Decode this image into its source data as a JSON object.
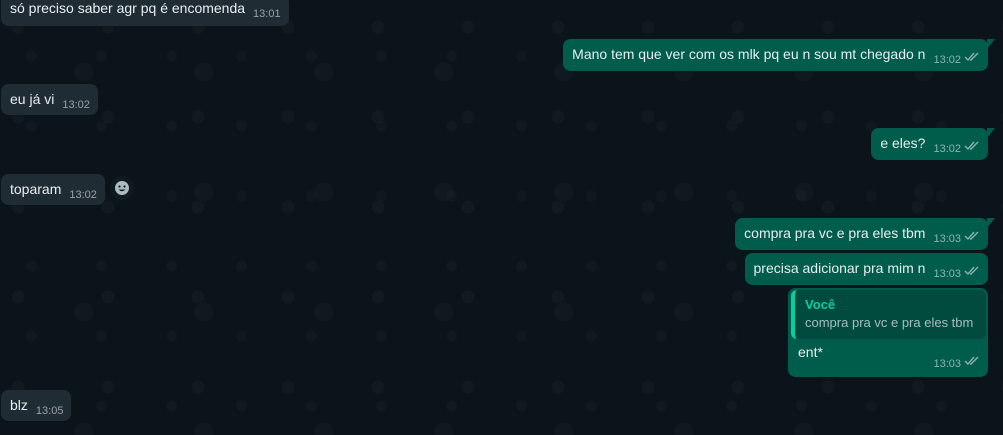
{
  "colors": {
    "background": "#0b141a",
    "incoming_bubble": "#202c33",
    "outgoing_bubble": "#005c4b",
    "quote_accent": "#06cf9c"
  },
  "messages": [
    {
      "direction": "in",
      "text": "só preciso saber agr pq é encomenda",
      "time": "13:01"
    },
    {
      "direction": "out",
      "text": "Mano tem que ver com os mlk pq eu n sou mt chegado n",
      "time": "13:02",
      "ticks": "double-check-icon"
    },
    {
      "direction": "in",
      "text": "eu já vi",
      "time": "13:02"
    },
    {
      "direction": "out",
      "text": "e eles?",
      "time": "13:02",
      "ticks": "double-check-icon"
    },
    {
      "direction": "in",
      "text": "toparam",
      "time": "13:02",
      "reaction_icon": "smiley-face-icon"
    },
    {
      "direction": "out",
      "text": "compra pra vc e pra eles tbm",
      "time": "13:03",
      "ticks": "double-check-icon"
    },
    {
      "direction": "out",
      "text": "precisa adicionar pra mim n",
      "time": "13:03",
      "ticks": "double-check-icon"
    },
    {
      "direction": "out",
      "text": "ent*",
      "time": "13:03",
      "ticks": "double-check-icon",
      "quote": {
        "author": "Você",
        "text": "compra pra vc e pra eles tbm"
      }
    },
    {
      "direction": "in",
      "text": "blz",
      "time": "13:05"
    }
  ]
}
